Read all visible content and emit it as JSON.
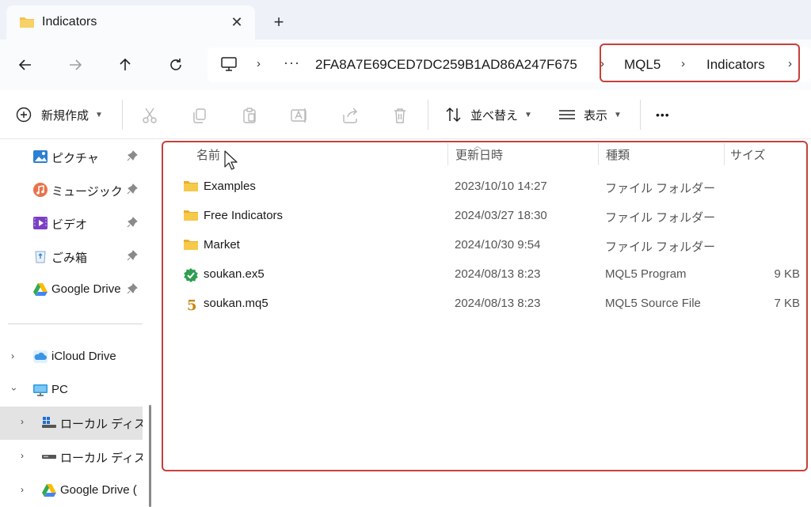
{
  "tab": {
    "title": "Indicators",
    "close": "✕",
    "new_tab": "+"
  },
  "address": {
    "ellipsis": "···",
    "segments": [
      "2FA8A7E69CED7DC259B1AD86A247F675",
      "MQL5",
      "Indicators"
    ],
    "separator": "›"
  },
  "toolbar": {
    "new_label": "新規作成",
    "sort_label": "並べ替え",
    "view_label": "表示",
    "more": "•••"
  },
  "sidebar": {
    "quick_access": [
      {
        "label": "ピクチャ",
        "icon": "pictures-icon"
      },
      {
        "label": "ミュージック",
        "icon": "music-icon"
      },
      {
        "label": "ビデオ",
        "icon": "videos-icon"
      },
      {
        "label": "ごみ箱",
        "icon": "recycle-bin-icon"
      },
      {
        "label": "Google Drive",
        "icon": "google-drive-icon"
      }
    ],
    "tree": [
      {
        "label": "iCloud Drive",
        "icon": "icloud-icon"
      },
      {
        "label": "PC",
        "icon": "pc-icon"
      },
      {
        "label": "ローカル ディスク (",
        "icon": "windows-drive-icon"
      },
      {
        "label": "ローカル ディスク (",
        "icon": "drive-icon"
      },
      {
        "label": "Google Drive (",
        "icon": "google-drive-icon"
      }
    ]
  },
  "columns": {
    "name": "名前",
    "date": "更新日時",
    "type": "種類",
    "size": "サイズ"
  },
  "files": [
    {
      "name": "Examples",
      "date": "2023/10/10 14:27",
      "type": "ファイル フォルダー",
      "size": "",
      "icon": "folder-icon"
    },
    {
      "name": "Free Indicators",
      "date": "2024/03/27 18:30",
      "type": "ファイル フォルダー",
      "size": "",
      "icon": "folder-icon"
    },
    {
      "name": "Market",
      "date": "2024/10/30 9:54",
      "type": "ファイル フォルダー",
      "size": "",
      "icon": "folder-icon"
    },
    {
      "name": "soukan.ex5",
      "date": "2024/08/13 8:23",
      "type": "MQL5 Program",
      "size": "9 KB",
      "icon": "ex5-icon"
    },
    {
      "name": "soukan.mq5",
      "date": "2024/08/13 8:23",
      "type": "MQL5 Source File",
      "size": "7 KB",
      "icon": "mq5-icon"
    }
  ],
  "colors": {
    "highlight": "#c8403a",
    "folder": "#f4c24b",
    "accent": "#2e7d32"
  }
}
